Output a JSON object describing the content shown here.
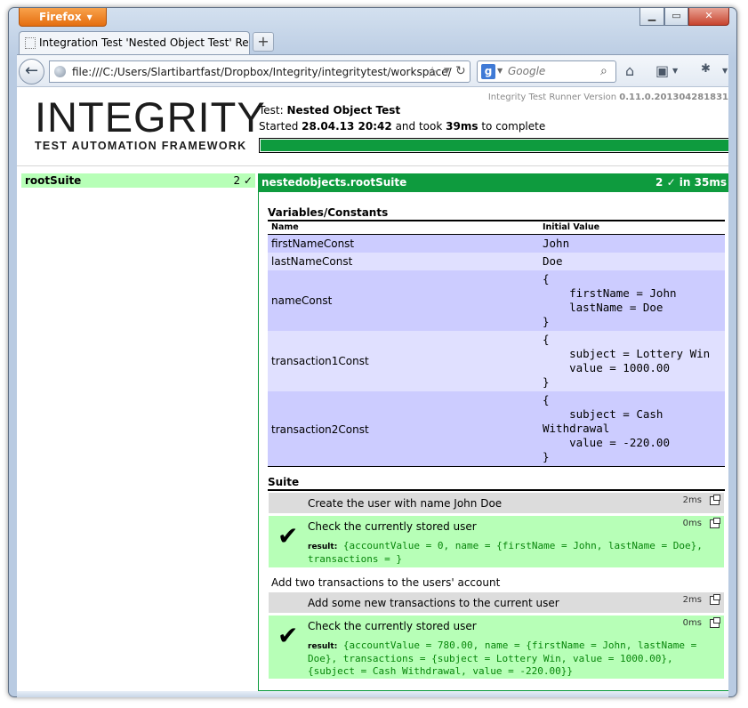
{
  "browser": {
    "menu_label": "Firefox",
    "tab_title": "Integration Test 'Nested Object Test' Res...",
    "url": "file:///C:/Users/Slartibartfast/Dropbox/Integrity/integritytest/workspace/",
    "search_engine": "g",
    "search_placeholder": "Google"
  },
  "header": {
    "logo_title": "INTEGRITY",
    "logo_subtitle": "TEST AUTOMATION FRAMEWORK",
    "version_prefix": "Integrity Test Runner Version",
    "version_number": "0.11.0.201304281831",
    "test_label": "Test:",
    "test_name": "Nested Object Test",
    "started_label": "Started",
    "started_at": "28.04.13 20:42",
    "took_label": "and took",
    "duration": "39ms",
    "complete_label": "to complete",
    "progress": 1.0
  },
  "sidebar": {
    "suite_name": "rootSuite",
    "suite_count": "2 ✓"
  },
  "main": {
    "suite_title": "nestedobjects.rootSuite",
    "suite_status": "2 ✓ in 35ms",
    "variables_title": "Variables/Constants",
    "col_name": "Name",
    "col_value": "Initial Value",
    "variables": [
      {
        "name": "firstNameConst",
        "value": "John"
      },
      {
        "name": "lastNameConst",
        "value": "Doe"
      },
      {
        "name": "nameConst",
        "value": "{\n    firstName = John\n    lastName = Doe\n}"
      },
      {
        "name": "transaction1Const",
        "value": "{\n    subject = Lottery Win\n    value = 1000.00\n}"
      },
      {
        "name": "transaction2Const",
        "value": "{\n    subject = Cash\nWithdrawal\n    value = -220.00\n}"
      }
    ],
    "suite_section_title": "Suite",
    "steps": [
      {
        "text": "Create the user with name John Doe",
        "time": "2ms"
      },
      {
        "text": "Check the currently stored user",
        "time": "0ms",
        "result_label": "result:",
        "result": "{accountValue = 0, name = {firstName = John, lastName = Doe},\ntransactions = }"
      },
      {
        "comment": "Add two transactions to the users' account"
      },
      {
        "text": "Add some new transactions to the current user",
        "time": "2ms"
      },
      {
        "text": "Check the currently stored user",
        "time": "0ms",
        "result_label": "result:",
        "result": "{accountValue = 780.00, name = {firstName = John, lastName =\nDoe}, transactions = {subject = Lottery Win, value = 1000.00},\n{subject = Cash Withdrawal, value = -220.00}}"
      }
    ]
  },
  "colors": {
    "pass_green": "#0e9b3e",
    "row_light_green": "#b7ffb7",
    "var_row_a": "#ccccff",
    "var_row_b": "#e0e0ff",
    "result_text": "#07860a"
  }
}
